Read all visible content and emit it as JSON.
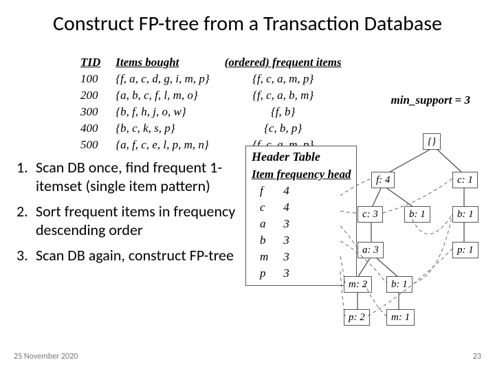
{
  "title": "Construct FP-tree from a Transaction Database",
  "table": {
    "headers": [
      "TID",
      "Items bought",
      "(ordered) frequent items"
    ],
    "rows": [
      {
        "tid": "100",
        "items": "{f, a, c, d, g, i, m, p}",
        "ord": "{f, c, a, m, p}"
      },
      {
        "tid": "200",
        "items": "{a, b, c, f, l, m, o}",
        "ord": "{f, c, a, b, m}"
      },
      {
        "tid": "300",
        "items": "{b, f, h, j, o, w}",
        "ord": "{f, b}"
      },
      {
        "tid": "400",
        "items": "{b, c, k, s, p}",
        "ord": "{c, b, p}"
      },
      {
        "tid": "500",
        "items": "{a, f, c, e, l, p, m, n}",
        "ord": "{f, c, a, m, p}"
      }
    ]
  },
  "min_support": "min_support = 3",
  "steps": [
    {
      "n": "1.",
      "t": "Scan DB once, find frequent 1-itemset (single item pattern)"
    },
    {
      "n": "2.",
      "t": "Sort frequent items in frequency descending order"
    },
    {
      "n": "3.",
      "t": "Scan DB again, construct FP-tree"
    }
  ],
  "header_table": {
    "title": "Header Table",
    "header": "Item  frequency  head",
    "rows": [
      {
        "item": "f",
        "freq": "4"
      },
      {
        "item": "c",
        "freq": "4"
      },
      {
        "item": "a",
        "freq": "3"
      },
      {
        "item": "b",
        "freq": "3"
      },
      {
        "item": "m",
        "freq": "3"
      },
      {
        "item": "p",
        "freq": "3"
      }
    ]
  },
  "tree": {
    "root": "{}",
    "nodes": {
      "f4": "f: 4",
      "c1": "c: 1",
      "c3": "c: 3",
      "b1a": "b: 1",
      "b1b": "b: 1",
      "a3": "a: 3",
      "p1": "p: 1",
      "m2": "m: 2",
      "b1c": "b: 1",
      "p2": "p: 2",
      "m1": "m: 1"
    }
  },
  "footer": {
    "date": "25 November 2020",
    "num": "23"
  }
}
